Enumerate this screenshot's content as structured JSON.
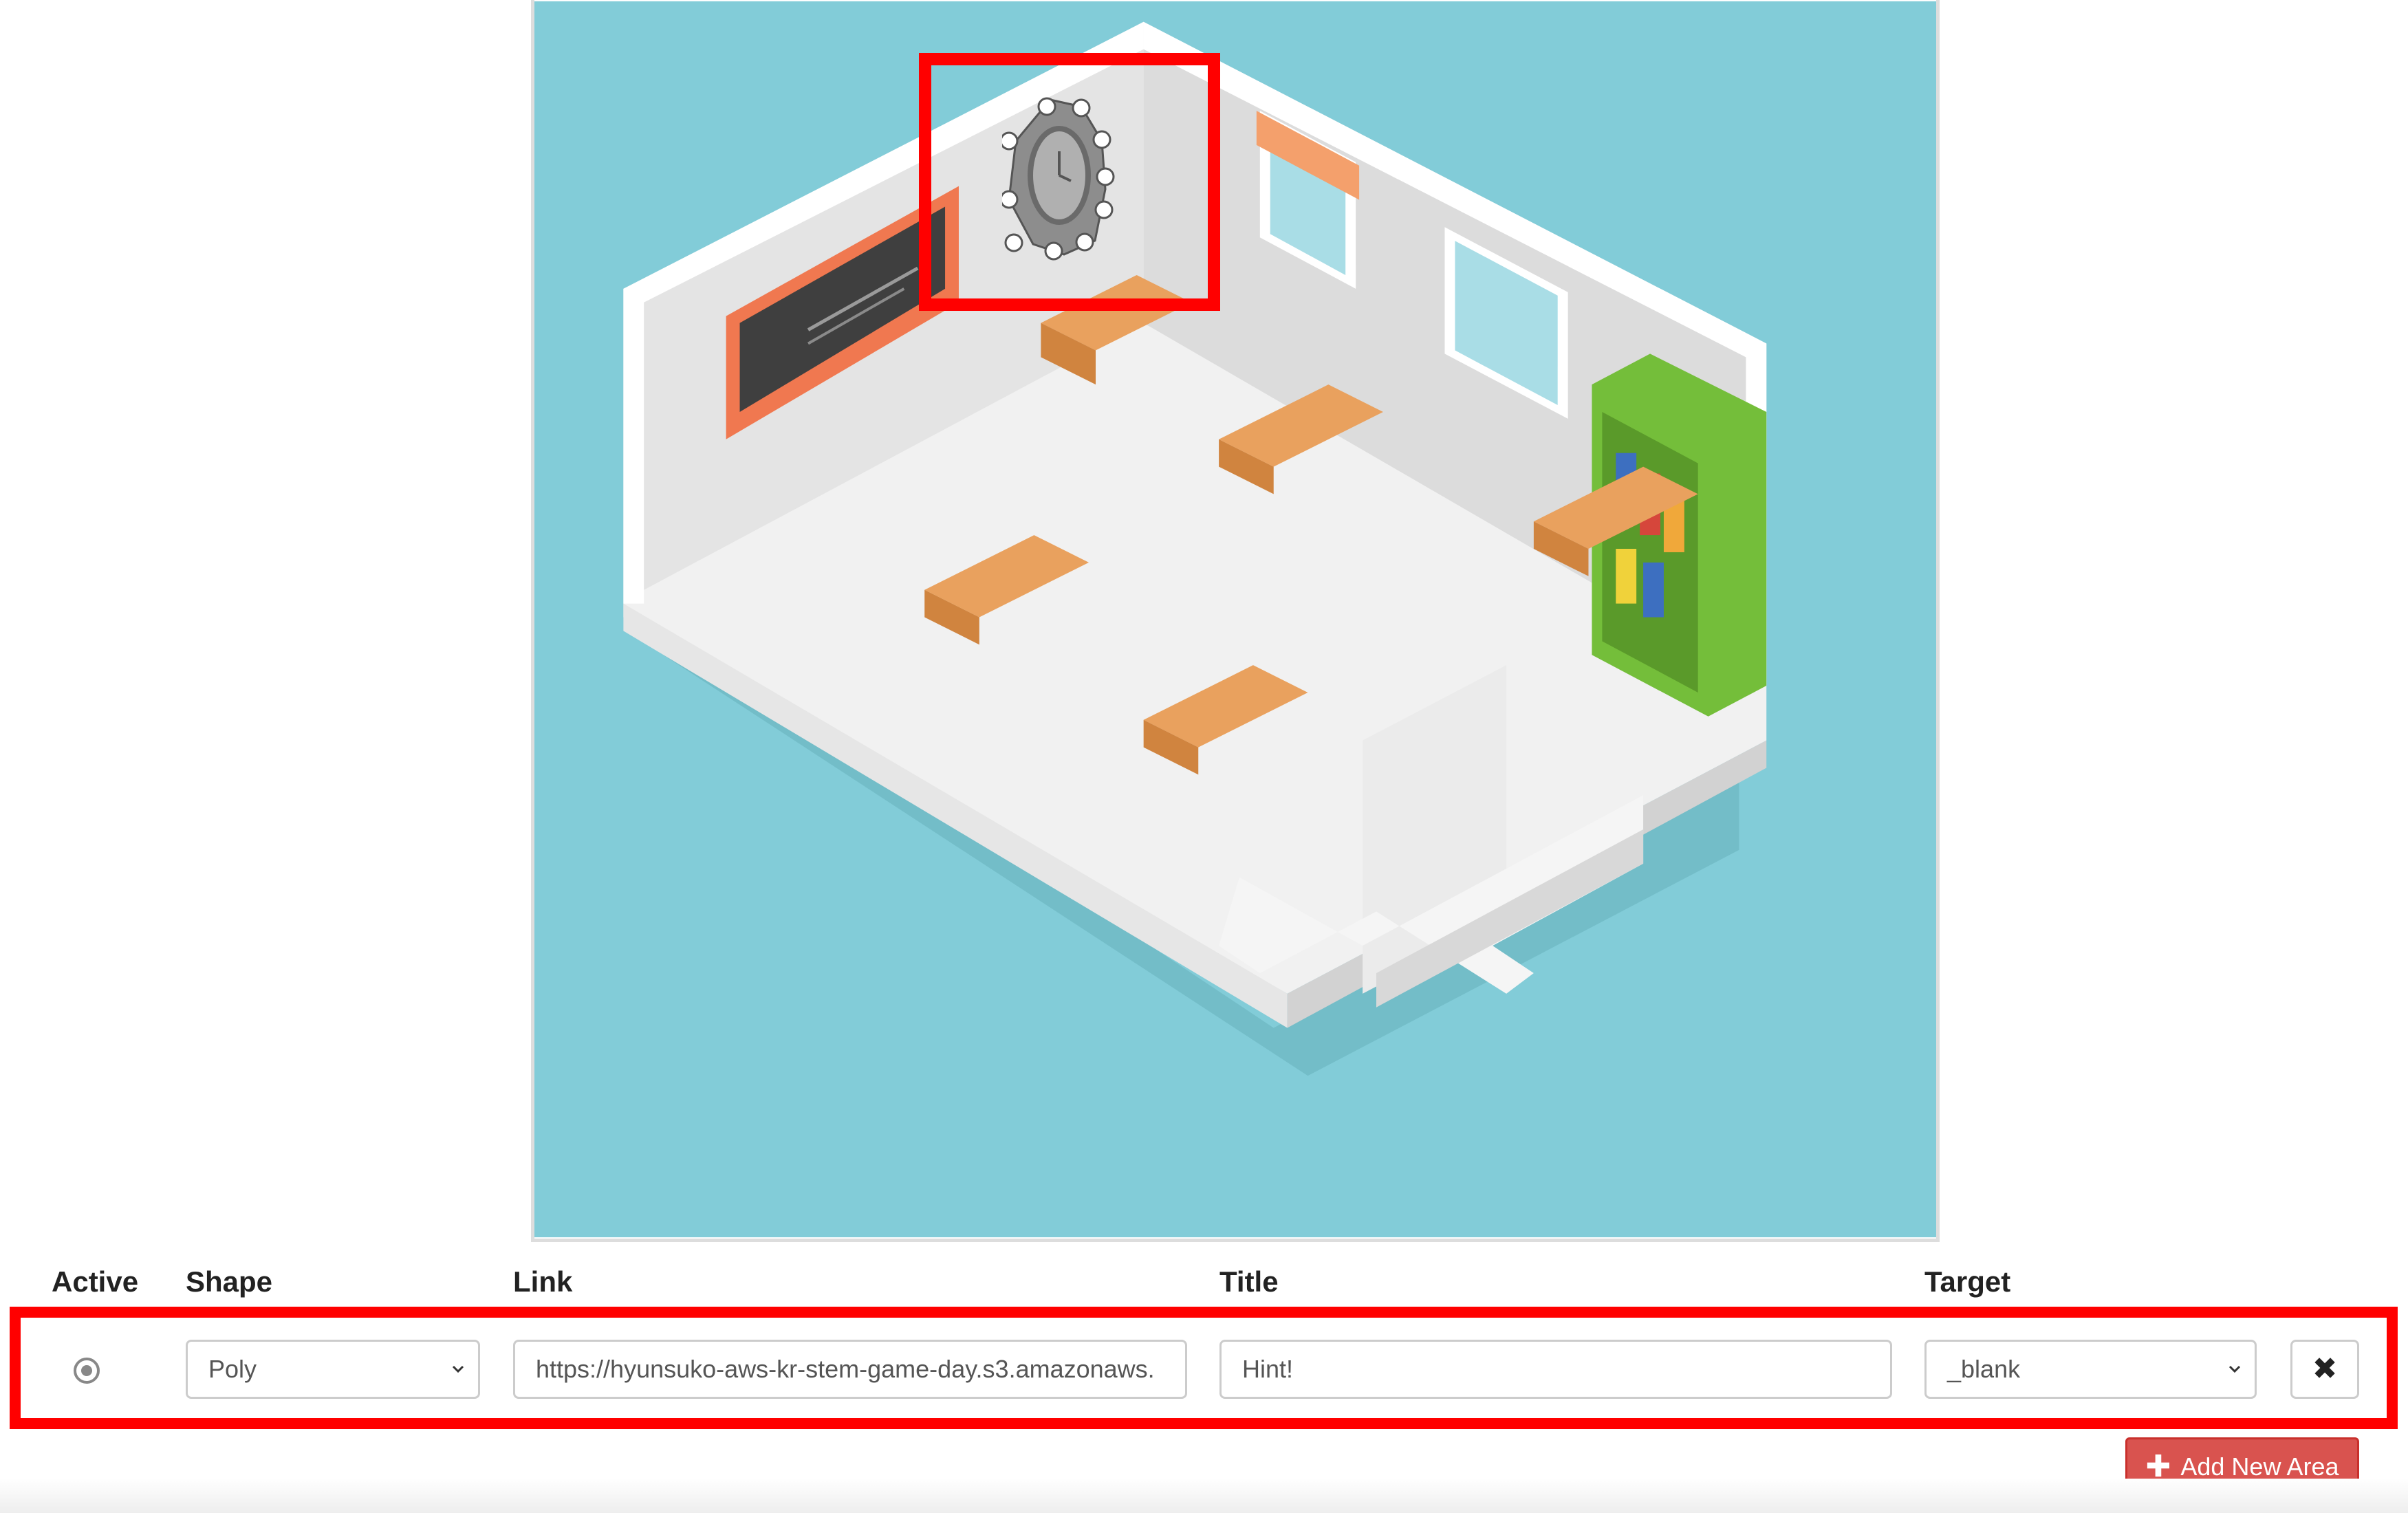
{
  "table": {
    "headers": {
      "active": "Active",
      "shape": "Shape",
      "link": "Link",
      "title": "Title",
      "target": "Target"
    },
    "row": {
      "active": true,
      "shape": "Poly",
      "link": "https://hyunsuko-aws-kr-stem-game-day.s3.amazonaws.",
      "title": "Hint!",
      "target": "_blank"
    }
  },
  "buttons": {
    "delete_icon": "✖",
    "add_icon": "✚",
    "add_label": "Add New Area"
  },
  "colors": {
    "highlight": "#ff0000",
    "add_button": "#d9534f",
    "background_teal": "#82ccd8"
  },
  "icons": [
    "clock-icon",
    "chevron-down-icon",
    "close-icon",
    "plus-icon"
  ]
}
